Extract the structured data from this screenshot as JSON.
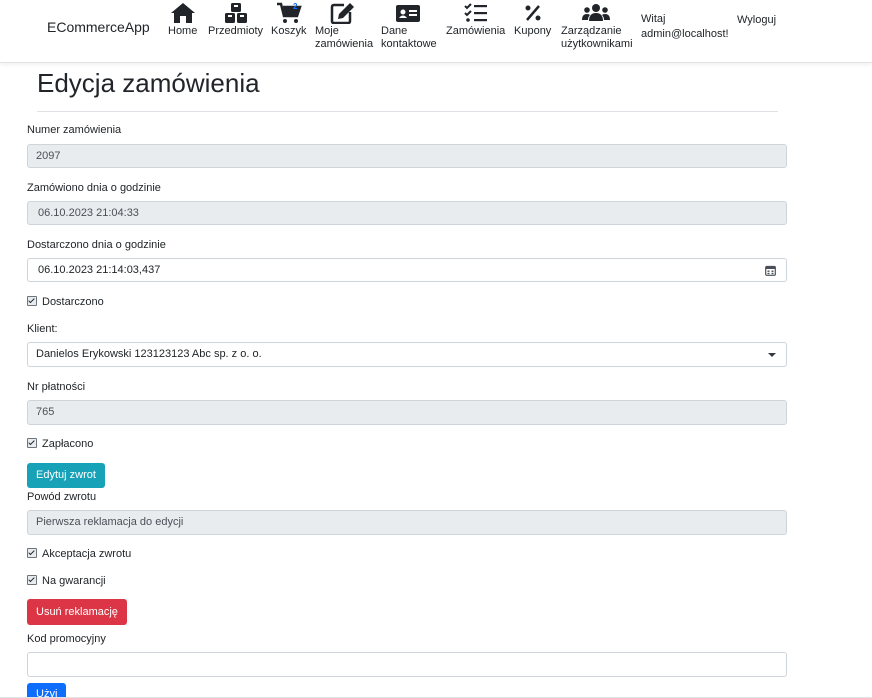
{
  "navbar": {
    "brand": "ECommerceApp",
    "items": [
      {
        "label": "Home",
        "icon": "home-icon"
      },
      {
        "label": "Przedmioty",
        "icon": "cubes-icon"
      },
      {
        "label": "Koszyk",
        "icon": "cart-icon",
        "badge": "2"
      },
      {
        "label_line1": "Moje",
        "label_line2": "zamówienia",
        "icon": "edit-icon"
      },
      {
        "label_line1": "Dane",
        "label_line2": "kontaktowe",
        "icon": "id-card-icon"
      },
      {
        "label": "Zamówienia",
        "icon": "list-check-icon"
      },
      {
        "label": "Kupony",
        "icon": "percent-icon"
      },
      {
        "label_line1": "Zarządzanie",
        "label_line2": "użytkownikami",
        "icon": "users-icon"
      }
    ],
    "greeting_line1": "Witaj",
    "greeting_line2": "admin@localhost!",
    "logout": "Wyloguj"
  },
  "page": {
    "title": "Edycja zamówienia"
  },
  "form": {
    "order_number": {
      "label": "Numer zamówienia",
      "value": "2097"
    },
    "ordered_at": {
      "label": "Zamówiono dnia o godzinie",
      "value": "06.10.2023 21:04:33"
    },
    "delivered_at": {
      "label": "Dostarczono dnia o godzinie",
      "value": "06.10.2023 21:14:03,437"
    },
    "delivered_check": {
      "label": "Dostarczono",
      "checked": true
    },
    "client": {
      "label": "Klient:",
      "value": "Danielos Erykowski 123123123 Abc sp. z o. o."
    },
    "payment_number": {
      "label": "Nr płatności",
      "value": "765"
    },
    "paid_check": {
      "label": "Zapłacono",
      "checked": true
    },
    "edit_return_button": "Edytuj zwrot",
    "return_reason": {
      "label": "Powód zwrotu",
      "value": "Pierwsza reklamacja do edycji"
    },
    "return_accepted_check": {
      "label": "Akceptacja zwrotu",
      "checked": true
    },
    "warranty_check": {
      "label": "Na gwarancji",
      "checked": true
    },
    "delete_complaint_button": "Usuń reklamację",
    "promo_code": {
      "label": "Kod promocyjny",
      "value": ""
    },
    "use_button": "Użyj"
  },
  "colors": {
    "info": "#17a2b8",
    "danger": "#dc3545",
    "primary": "#0d6efd",
    "readonly_bg": "#e9ecef"
  }
}
